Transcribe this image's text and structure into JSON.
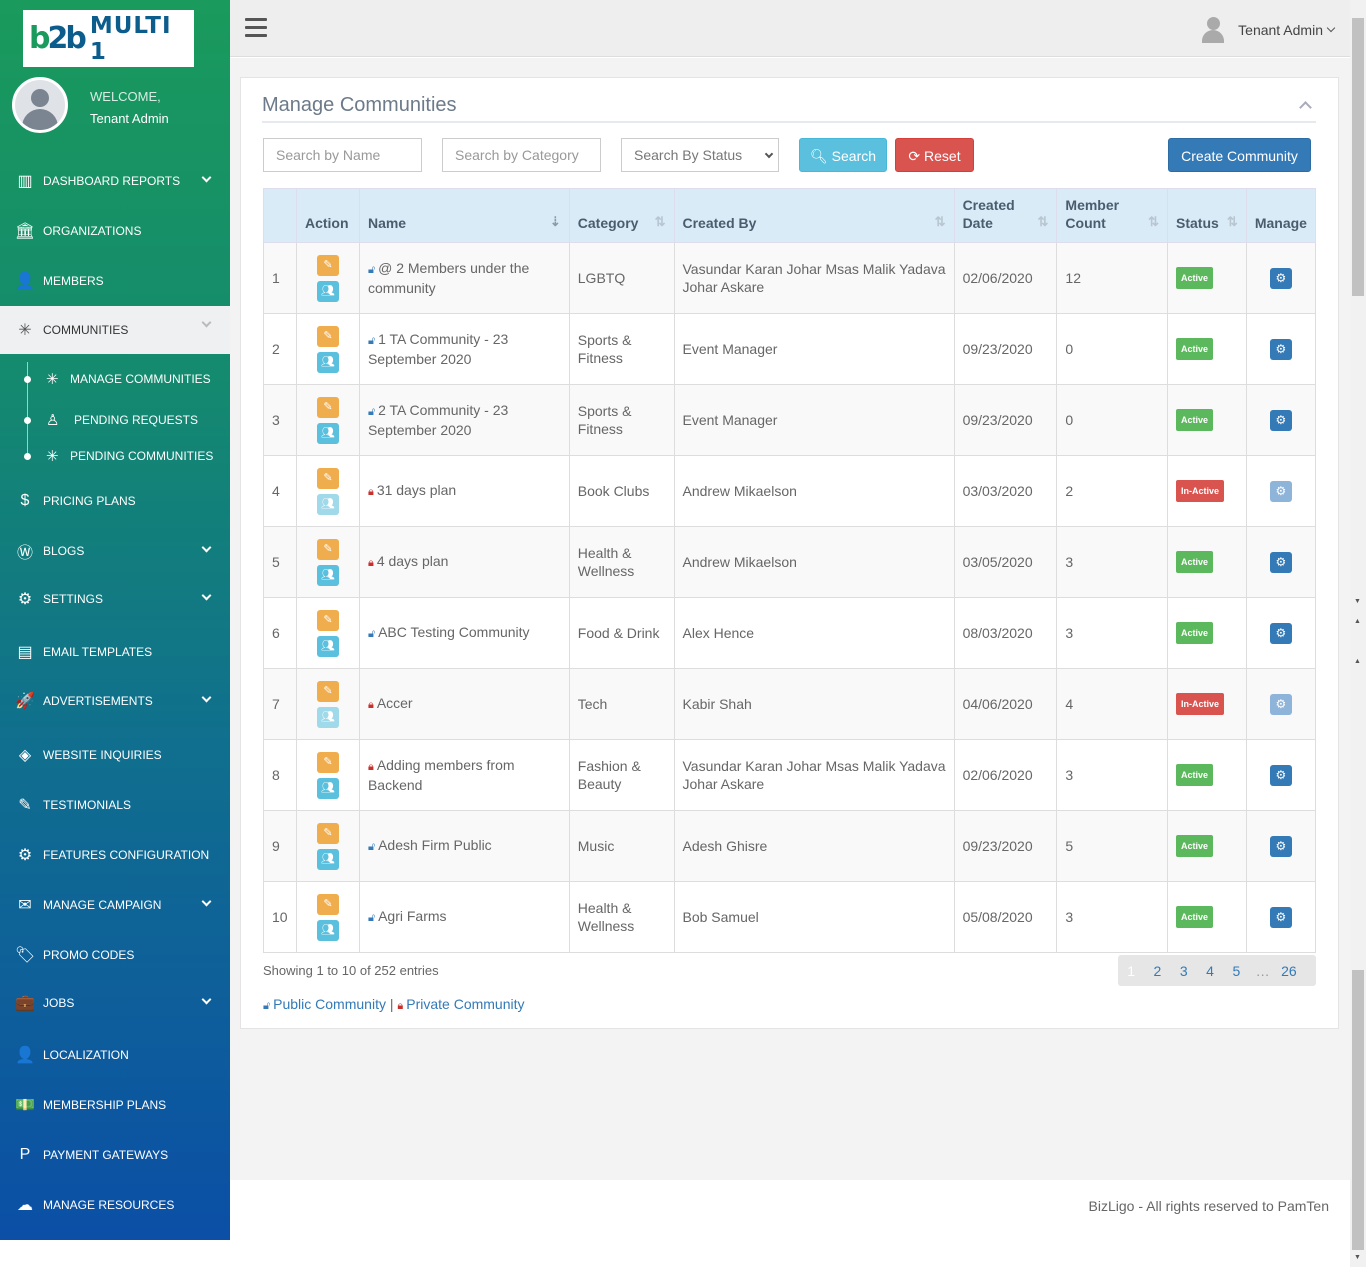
{
  "brand": {
    "mark_b": "b",
    "mark_2b": "2b",
    "name": "MULTI 1"
  },
  "user": {
    "welcome": "WELCOME,",
    "name": "Tenant Admin"
  },
  "topbar": {
    "user_menu": "Tenant Admin"
  },
  "sidebar": {
    "items": [
      {
        "label": "DASHBOARD REPORTS",
        "icon": "bar-chart-icon",
        "glyph": "▥",
        "has_chevron": true
      },
      {
        "label": "ORGANIZATIONS",
        "icon": "bank-icon",
        "glyph": "🏛",
        "has_chevron": false
      },
      {
        "label": "MEMBERS",
        "icon": "user-icon",
        "glyph": "👤",
        "has_chevron": false
      },
      {
        "label": "COMMUNITIES",
        "icon": "network-icon",
        "glyph": "✳",
        "has_chevron": true,
        "active": true
      },
      {
        "label": "PRICING PLANS",
        "icon": "dollar-icon",
        "glyph": "$",
        "has_chevron": false
      },
      {
        "label": "BLOGS",
        "icon": "wordpress-icon",
        "glyph": "Ⓦ",
        "has_chevron": true
      },
      {
        "label": "SETTINGS",
        "icon": "gears-icon",
        "glyph": "⚙",
        "has_chevron": true
      },
      {
        "label": "EMAIL TEMPLATES",
        "icon": "template-icon",
        "glyph": "▤",
        "has_chevron": false
      },
      {
        "label": "ADVERTISEMENTS",
        "icon": "rocket-icon",
        "glyph": "🚀",
        "has_chevron": true
      },
      {
        "label": "WEBSITE INQUIRIES",
        "icon": "tag-icon",
        "glyph": "◈",
        "has_chevron": false
      },
      {
        "label": "TESTIMONIALS",
        "icon": "edit-icon",
        "glyph": "✎",
        "has_chevron": false
      },
      {
        "label": "FEATURES CONFIGURATION",
        "icon": "cog-icon",
        "glyph": "⚙",
        "has_chevron": false
      },
      {
        "label": "MANAGE CAMPAIGN",
        "icon": "envelope-icon",
        "glyph": "✉",
        "has_chevron": true
      },
      {
        "label": "PROMO CODES",
        "icon": "tag-icon",
        "glyph": "🏷",
        "has_chevron": false
      },
      {
        "label": "JOBS",
        "icon": "briefcase-icon",
        "glyph": "💼",
        "has_chevron": true
      },
      {
        "label": "LOCALIZATION",
        "icon": "user-icon",
        "glyph": "👤",
        "has_chevron": false
      },
      {
        "label": "MEMBERSHIP PLANS",
        "icon": "money-icon",
        "glyph": "💵",
        "has_chevron": false
      },
      {
        "label": "PAYMENT GATEWAYS",
        "icon": "paypal-icon",
        "glyph": "P",
        "has_chevron": false
      },
      {
        "label": "MANAGE RESOURCES",
        "icon": "cloud-upload-icon",
        "glyph": "☁",
        "has_chevron": false
      }
    ],
    "sub_items": [
      {
        "label": "MANAGE COMMUNITIES",
        "icon": "network-icon",
        "glyph": "✳"
      },
      {
        "label": "PENDING REQUESTS",
        "icon": "child-icon",
        "glyph": "♙"
      },
      {
        "label": "PENDING COMMUNITIES",
        "icon": "network-icon",
        "glyph": "✳"
      }
    ]
  },
  "panel": {
    "title": "Manage Communities"
  },
  "filters": {
    "name_placeholder": "Search by Name",
    "category_placeholder": "Search by Category",
    "status_placeholder": "Search By Status",
    "search_label": "Search",
    "reset_label": "Reset",
    "create_label": "Create Community"
  },
  "table": {
    "headers": {
      "action": "Action",
      "name": "Name",
      "category": "Category",
      "created_by": "Created By",
      "created_date_1": "Created",
      "created_date_2": "Date",
      "member_count_1": "Member",
      "member_count_2": "Count",
      "status": "Status",
      "manage": "Manage"
    },
    "rows": [
      {
        "n": "1",
        "name": "@ 2 Members under the community",
        "public": true,
        "category": "LGBTQ",
        "created_by": "Vasundar Karan Johar Msas Malik Yadava Johar Askare",
        "date": "02/06/2020",
        "count": "12",
        "status": "Active"
      },
      {
        "n": "2",
        "name": "1 TA Community - 23 September 2020",
        "public": true,
        "category": "Sports & Fitness",
        "created_by": "Event Manager",
        "date": "09/23/2020",
        "count": "0",
        "status": "Active"
      },
      {
        "n": "3",
        "name": "2 TA Community - 23 September 2020",
        "public": true,
        "category": "Sports & Fitness",
        "created_by": "Event Manager",
        "date": "09/23/2020",
        "count": "0",
        "status": "Active"
      },
      {
        "n": "4",
        "name": "31 days plan",
        "public": false,
        "category": "Book Clubs",
        "created_by": "Andrew Mikaelson",
        "date": "03/03/2020",
        "count": "2",
        "status": "In-Active"
      },
      {
        "n": "5",
        "name": "4 days plan",
        "public": false,
        "category": "Health & Wellness",
        "created_by": "Andrew Mikaelson",
        "date": "03/05/2020",
        "count": "3",
        "status": "Active"
      },
      {
        "n": "6",
        "name": "ABC Testing Community",
        "public": true,
        "category": "Food & Drink",
        "created_by": "Alex Hence",
        "date": "08/03/2020",
        "count": "3",
        "status": "Active"
      },
      {
        "n": "7",
        "name": "Accer",
        "public": false,
        "category": "Tech",
        "created_by": "Kabir Shah",
        "date": "04/06/2020",
        "count": "4",
        "status": "In-Active"
      },
      {
        "n": "8",
        "name": "Adding members from Backend",
        "public": false,
        "category": "Fashion & Beauty",
        "created_by": "Vasundar Karan Johar Msas Malik Yadava Johar Askare",
        "date": "02/06/2020",
        "count": "3",
        "status": "Active"
      },
      {
        "n": "9",
        "name": "Adesh Firm Public",
        "public": true,
        "category": "Music",
        "created_by": "Adesh Ghisre",
        "date": "09/23/2020",
        "count": "5",
        "status": "Active"
      },
      {
        "n": "10",
        "name": "Agri Farms",
        "public": true,
        "category": "Health & Wellness",
        "created_by": "Bob Samuel",
        "date": "05/08/2020",
        "count": "3",
        "status": "Active"
      }
    ]
  },
  "showing": "Showing 1 to 10 of 252 entries",
  "pagination": [
    "1",
    "2",
    "3",
    "4",
    "5",
    "…",
    "26"
  ],
  "legend": {
    "public": "Public Community",
    "separator": "|",
    "private": "Private Community"
  },
  "footer": "BizLigo - All rights reserved to PamTen",
  "colors": {
    "active": "#5cb85c",
    "inactive": "#d9534f",
    "primary": "#337ab7",
    "info": "#5bc0de",
    "warning": "#f0ad4e"
  }
}
